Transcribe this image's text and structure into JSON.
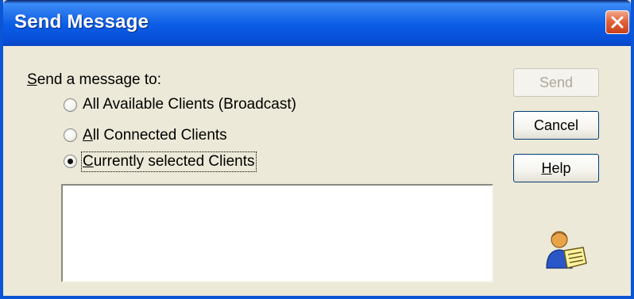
{
  "window": {
    "title": "Send Message"
  },
  "prompt_label": "Send a message to:",
  "options": [
    {
      "label": "All Available Clients (Broadcast)",
      "selected": false
    },
    {
      "label": "All Connected Clients",
      "selected": false
    },
    {
      "label": "Currently selected Clients",
      "selected": true
    }
  ],
  "buttons": {
    "send": {
      "label": "Send",
      "enabled": false
    },
    "cancel": {
      "label": "Cancel",
      "enabled": true
    },
    "help": {
      "label": "Help",
      "enabled": true
    }
  },
  "icons": {
    "close": "close-icon",
    "message": "user-message-icon"
  },
  "colors": {
    "titlebar": "#0b5ce6",
    "dialog_bg": "#ece9d8",
    "close": "#e2653c"
  }
}
